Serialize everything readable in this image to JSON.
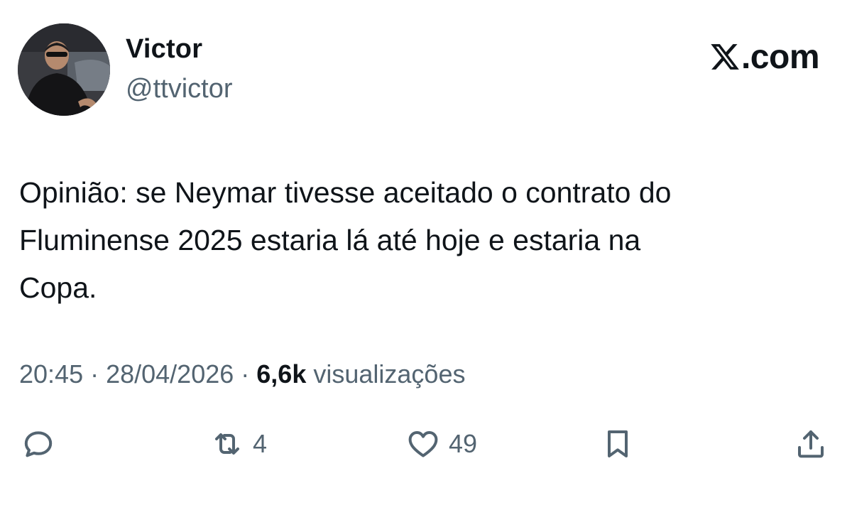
{
  "author": {
    "display_name": "Victor",
    "handle": "@ttvictor"
  },
  "brand": {
    "label": ".com",
    "icon": "x-logo-icon"
  },
  "tweet": {
    "text": "Opinião: se Neymar tivesse aceitado o contrato do\nFluminense 2025 estaria lá até hoje e estaria na\nCopa."
  },
  "meta": {
    "time": "20:45",
    "separator": " · ",
    "date": "28/04/2026",
    "views_count": "6,6k",
    "views_label": " visualizações"
  },
  "actions": {
    "reply": {
      "icon": "reply-icon"
    },
    "retweet": {
      "icon": "retweet-icon",
      "count": "4"
    },
    "like": {
      "icon": "heart-icon",
      "count": "49"
    },
    "bookmark": {
      "icon": "bookmark-icon"
    },
    "share": {
      "icon": "share-icon"
    }
  },
  "colors": {
    "text": "#0f1419",
    "secondary": "#536471",
    "background": "#ffffff"
  }
}
